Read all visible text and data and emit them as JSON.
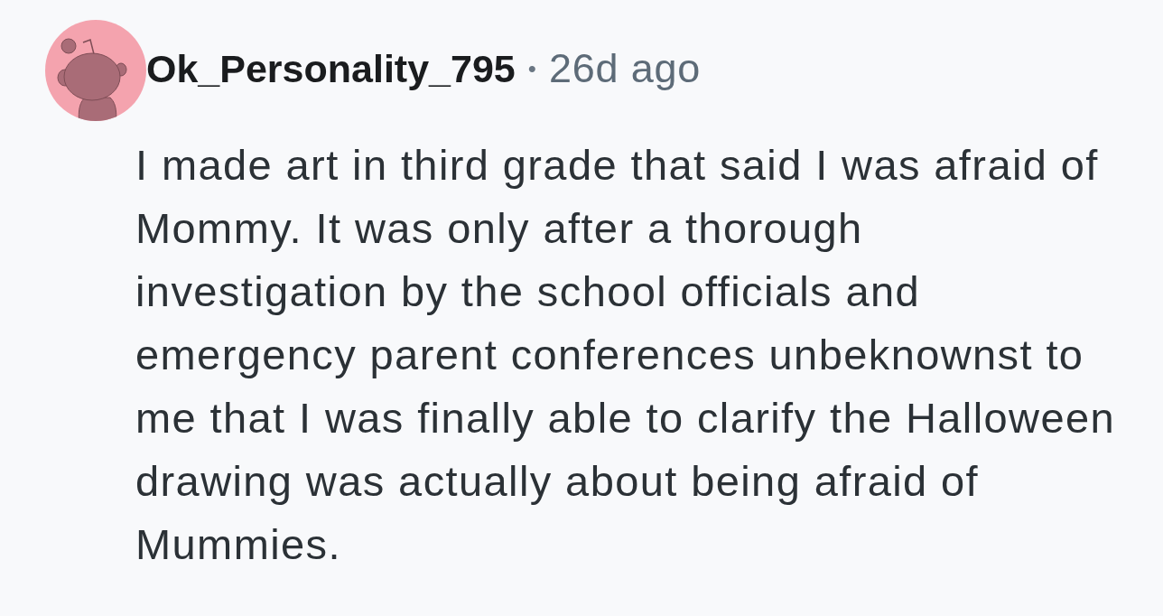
{
  "comment": {
    "author": "Ok_Personality_795",
    "separator": "•",
    "time": "26d ago",
    "body": "I made art in third grade that said I was afraid of Mommy. It was only after a thorough investigation by the school officials and emergency parent conferences unbeknownst to me that I was finally able to clarify the Halloween drawing was actually about being afraid of Mummies."
  }
}
